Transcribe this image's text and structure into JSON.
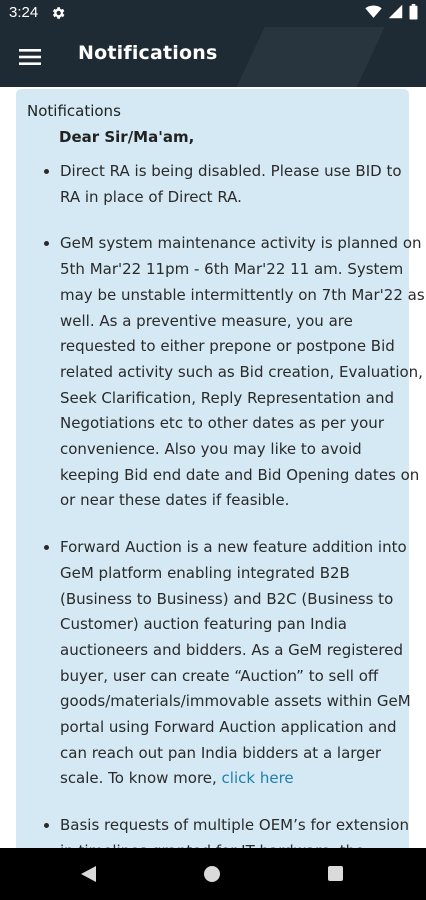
{
  "status_bar": {
    "time": "3:24",
    "icons": [
      "gear-icon",
      "wifi-icon",
      "signal-icon",
      "battery-icon"
    ]
  },
  "app_bar": {
    "title": "Notifications",
    "menu_icon": "hamburger-menu-icon"
  },
  "panel": {
    "heading": "Notifications",
    "greeting": "Dear Sir/Ma'am,",
    "items": [
      {
        "text": "Direct RA is being disabled. Please use BID to RA in place of Direct RA."
      },
      {
        "text": "GeM system maintenance activity is planned on 5th Mar'22 11pm - 6th Mar'22 11 am. System may be unstable intermittently on 7th Mar'22 as well. As a preventive measure, you are requested to either prepone or postpone Bid related activity such as Bid creation, Evaluation, Seek Clarification, Reply Representation and Negotiations etc to other dates as per your convenience. Also you may like to avoid keeping Bid end date and Bid Opening dates on or near these dates if feasible."
      },
      {
        "text": "Forward Auction is a new feature addition into GeM platform enabling integrated B2B (Business to Business) and B2C (Business to Customer) auction featuring pan India auctioneers and bidders. As a GeM registered buyer, user can create “Auction” to sell off goods/materials/immovable assets within GeM portal using Forward Auction application and can reach out pan India bidders at a larger scale. To know more, ",
        "link": "click here"
      },
      {
        "text": "Basis requests of multiple OEM’s for extension in timelines granted for IT hardware, the timeline"
      }
    ]
  },
  "nav_bar": {
    "icons": [
      "back-icon",
      "home-icon",
      "recents-icon"
    ]
  },
  "colors": {
    "app_bar": "#1e2b34",
    "panel": "#d5e9f4",
    "link": "#1f7fae"
  }
}
